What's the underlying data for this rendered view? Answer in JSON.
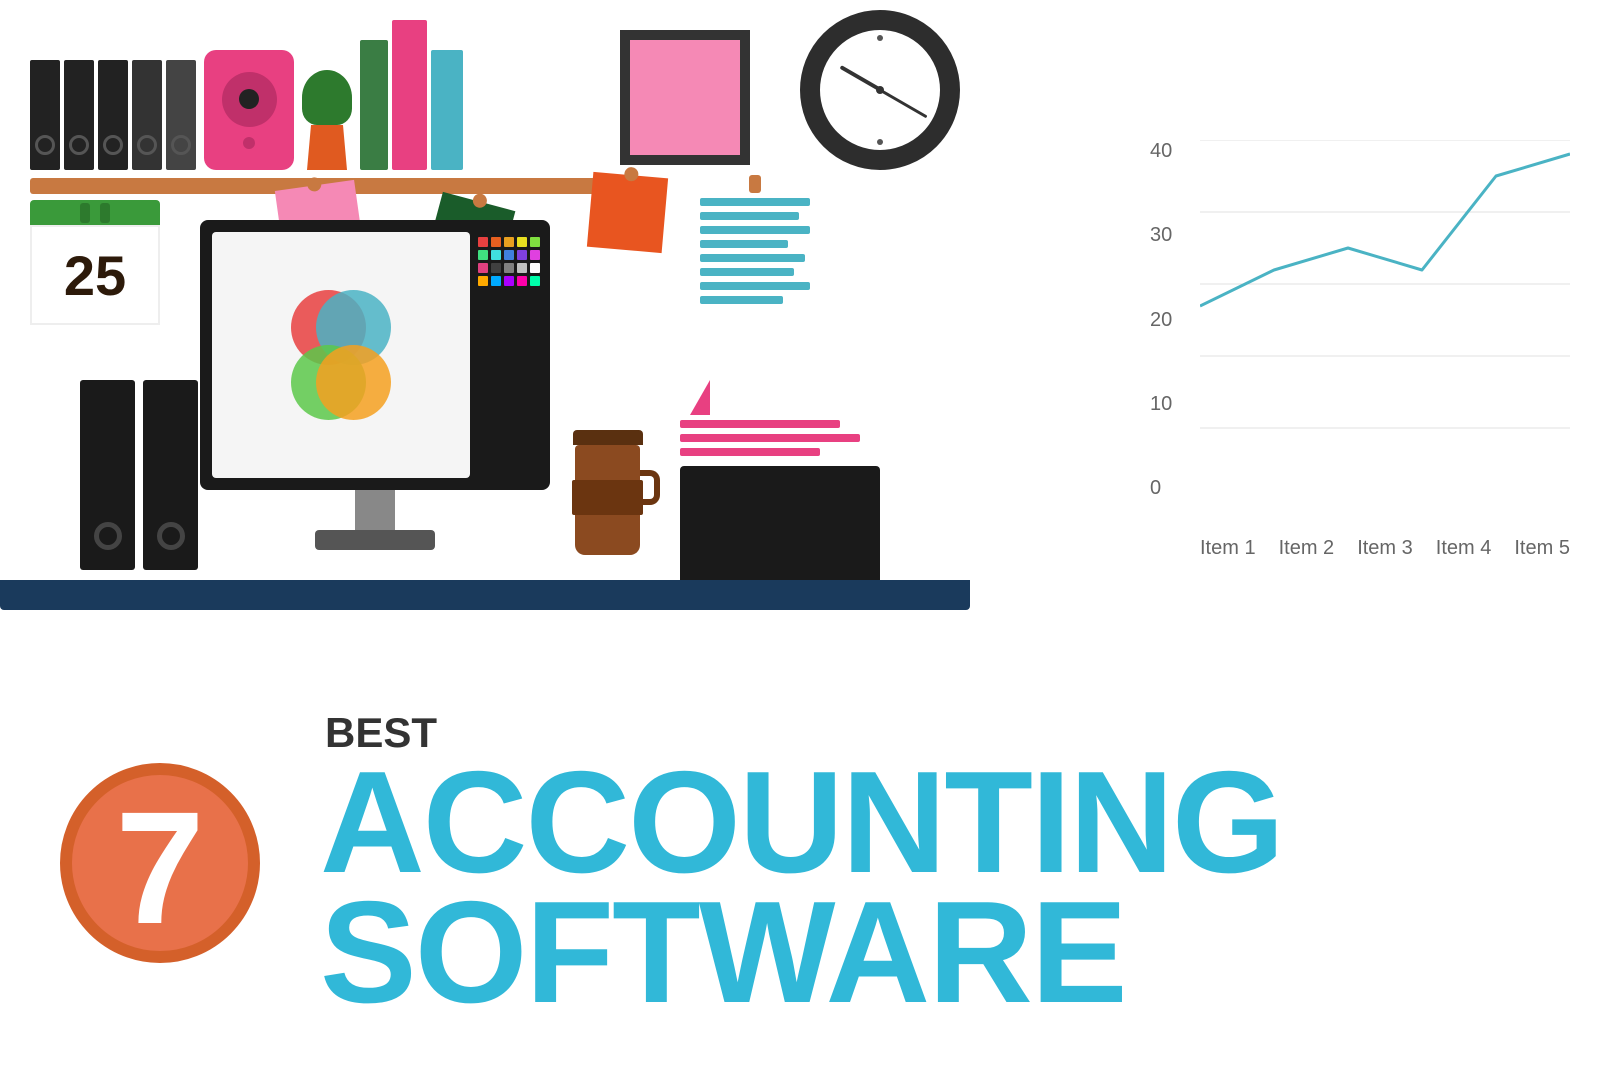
{
  "title": "7 Best Accounting Software",
  "top_illustration": {
    "calendar_number": "25",
    "chart": {
      "y_labels": [
        "40",
        "30",
        "20",
        "10",
        "0"
      ],
      "x_labels": [
        "Item 1",
        "Item 2",
        "Item 3",
        "Item 4",
        "Item 5"
      ],
      "data_points": [
        {
          "x": 0,
          "y": 17
        },
        {
          "x": 1,
          "y": 22
        },
        {
          "x": 2,
          "y": 25
        },
        {
          "x": 3,
          "y": 22
        },
        {
          "x": 4,
          "y": 35
        },
        {
          "x": 5,
          "y": 38
        }
      ],
      "line_color": "#4ab3c4",
      "y_max": 40,
      "y_min": 0
    }
  },
  "bottom": {
    "number": "7",
    "best_label": "BEST",
    "line1": "ACCOUNTING",
    "line2": "SOFTWARE"
  }
}
